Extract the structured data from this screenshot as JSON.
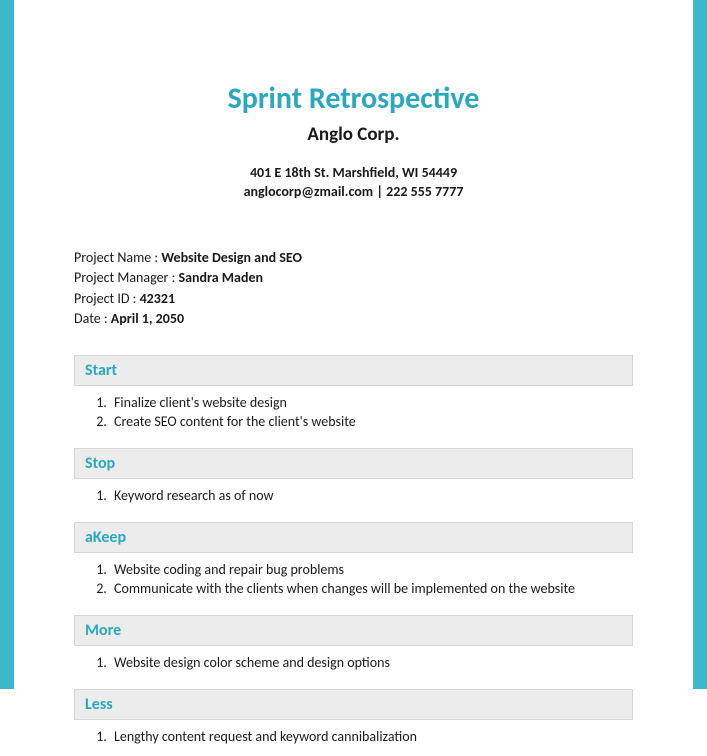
{
  "header": {
    "title": "Sprint Retrospective",
    "company": "Anglo Corp.",
    "address": "401 E 18th St. Marshfield, WI 54449",
    "contact": "anglocorp@zmail.com | 222 555 7777"
  },
  "meta": {
    "project_name_label": "Project Name : ",
    "project_name_value": "Website Design and SEO",
    "project_manager_label": "Project Manager : ",
    "project_manager_value": "Sandra Maden",
    "project_id_label": "Project ID : ",
    "project_id_value": "42321",
    "date_label": "Date : ",
    "date_value": "April 1, 2050"
  },
  "sections": {
    "start": {
      "heading": "Start",
      "items": [
        "Finalize client's website design",
        "Create SEO content for the client's website"
      ]
    },
    "stop": {
      "heading": "Stop",
      "items": [
        "Keyword research as of now"
      ]
    },
    "keep": {
      "heading": "aKeep",
      "items": [
        "Website coding and repair bug problems",
        "Communicate with the clients when changes will be implemented on the website"
      ]
    },
    "more": {
      "heading": "More",
      "items": [
        "Website design color scheme and design options"
      ]
    },
    "less": {
      "heading": "Less",
      "items": [
        "Lengthy content request and keyword cannibalization"
      ]
    }
  }
}
